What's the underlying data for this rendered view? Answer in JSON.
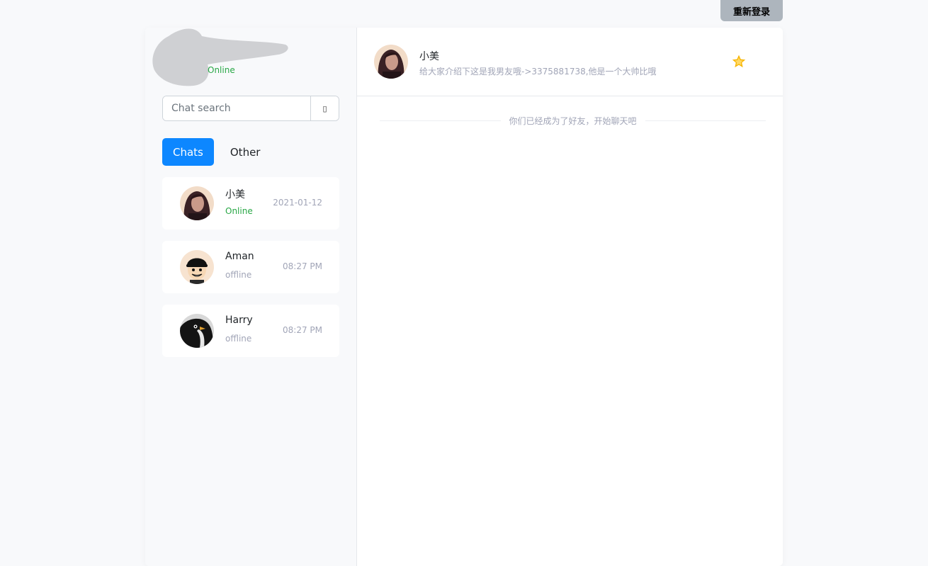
{
  "top": {
    "relogin_label": "重新登录"
  },
  "profile": {
    "status": "Online"
  },
  "search": {
    "placeholder": "Chat search",
    "button_glyph": "▯"
  },
  "tabs": [
    {
      "label": "Chats",
      "active": true
    },
    {
      "label": "Other",
      "active": false
    }
  ],
  "chats": [
    {
      "name": "小美",
      "status": "Online",
      "time": "2021-01-12",
      "avatar": "woman-avatar"
    },
    {
      "name": "Aman",
      "status": "offline",
      "time": "08:27 PM",
      "avatar": "cartoon-avatar"
    },
    {
      "name": "Harry",
      "status": "offline",
      "time": "08:27 PM",
      "avatar": "penguin-avatar"
    }
  ],
  "conversation": {
    "name": "小美",
    "description": "给大家介绍下这是我男友哦->3375881738,他是一个大帅比哦",
    "system_message": "你们已经成为了好友，开始聊天吧"
  },
  "colors": {
    "accent": "#0d87ff",
    "online": "#28a745",
    "muted": "#a1a5b7",
    "star": "#f7b500"
  }
}
